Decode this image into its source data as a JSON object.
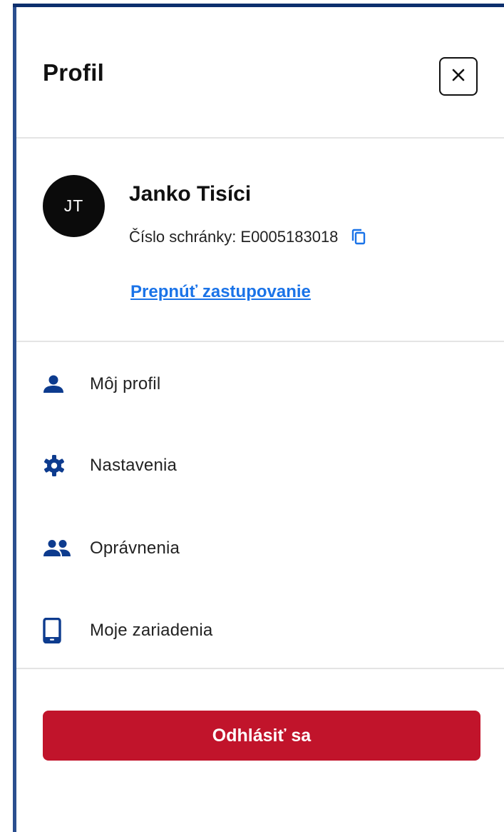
{
  "header": {
    "title": "Profil",
    "close_icon": "close-icon"
  },
  "user": {
    "initials": "JT",
    "name": "Janko Tisíci",
    "mailbox_label": "Číslo schránky:",
    "mailbox_value": "E0005183018",
    "copy_icon": "copy-icon",
    "switch_link": "Prepnúť zastupovanie"
  },
  "menu": {
    "items": [
      {
        "label": "Môj profil",
        "icon": "person-icon"
      },
      {
        "label": "Nastavenia",
        "icon": "gear-icon"
      },
      {
        "label": "Oprávnenia",
        "icon": "people-icon"
      },
      {
        "label": "Moje zariadenia",
        "icon": "phone-icon"
      }
    ]
  },
  "logout": {
    "label": "Odhlásiť sa"
  },
  "colors": {
    "accent_blue": "#0d3b8e",
    "link_blue": "#1a73e8",
    "logout_red": "#c1142b",
    "panel_border": "#2b4f8f"
  }
}
